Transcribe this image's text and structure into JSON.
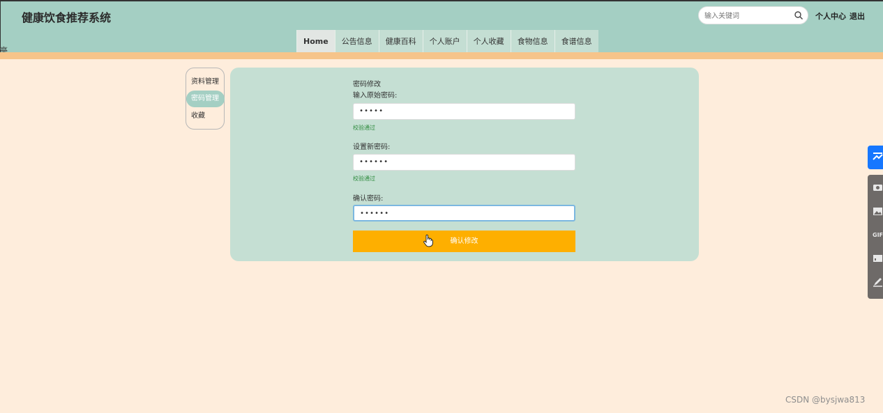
{
  "header": {
    "title": "健康饮食推荐系统",
    "search_placeholder": "输入关键词",
    "links": [
      "个人中心",
      "退出"
    ]
  },
  "nav": {
    "items": [
      {
        "label": "Home",
        "active": true
      },
      {
        "label": "公告信息"
      },
      {
        "label": "健康百科"
      },
      {
        "label": "个人账户"
      },
      {
        "label": "个人收藏"
      },
      {
        "label": "食物信息"
      },
      {
        "label": "食谱信息"
      }
    ]
  },
  "stray_char": "亭",
  "sidebar": {
    "items": [
      {
        "label": "资料管理"
      },
      {
        "label": "密码管理",
        "active": true
      },
      {
        "label": "收藏"
      }
    ]
  },
  "form": {
    "heading": "密码修改",
    "old_label": "输入原始密码:",
    "old_value": "•••••",
    "old_status": "校验通过",
    "new_label": "设置新密码:",
    "new_value": "••••••",
    "new_status": "校验通过",
    "confirm_label": "确认密码:",
    "confirm_value": "••••••",
    "submit_label": "确认修改"
  },
  "colors": {
    "header_bg": "#a4cfc3",
    "accent_orange": "#feaf00",
    "panel_bg": "#c5dfd3",
    "page_bg": "#feeddc"
  },
  "watermark": "CSDN @bysjwa813"
}
